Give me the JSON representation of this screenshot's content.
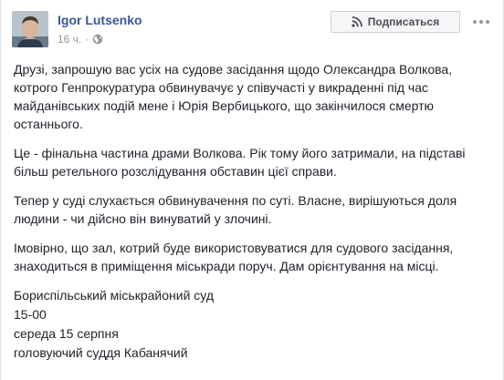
{
  "post": {
    "author": "Igor Lutsenko",
    "time": "16 ч.",
    "privacy_icon": "globe-icon",
    "subscribe_icon": "rss-icon",
    "subscribe_label": "Подписаться",
    "more_icon": "more-horizontal-icon",
    "paragraphs": [
      "Друзі, запрошую вас усіх на судове засідання щодо Олександра Волкова, котрого Генпрокуратура обвинувачує у співучасті у викраденні під час майданівських подій мене і Юрія Вербицького, що закінчилося смертю останнього.",
      "Це - фінальна частина драми Волкова. Рік тому його затримали, на підставі більш ретельного розслідування обставин цієї справи.",
      "Тепер у суді слухається обвинувачення по суті. Власне, вирішуються доля людини - чи дійсно він винуватий у злочині.",
      "Імовірно, що зал, котрий буде використовуватися для судового засідання, знаходиться в приміщення міськради поруч. Дам орієнтування на місці."
    ],
    "details": [
      "Бориспільський міськрайоний суд",
      "15-00",
      "середа 15 серпня",
      "головуючий суддя Кабанячий"
    ]
  }
}
